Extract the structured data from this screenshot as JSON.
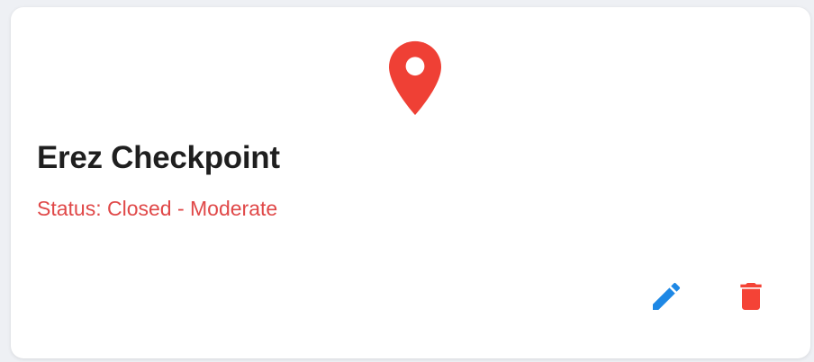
{
  "card": {
    "title": "Erez Checkpoint",
    "status": "Status: Closed - Moderate",
    "icon": "map-pin-icon",
    "actions": [
      {
        "name": "edit",
        "icon": "pencil-icon"
      },
      {
        "name": "delete",
        "icon": "trash-icon"
      }
    ]
  },
  "colors": {
    "pin": "#ef4035",
    "status_text": "#e04848",
    "edit_icon": "#1e88e5",
    "delete_icon": "#f44336"
  }
}
